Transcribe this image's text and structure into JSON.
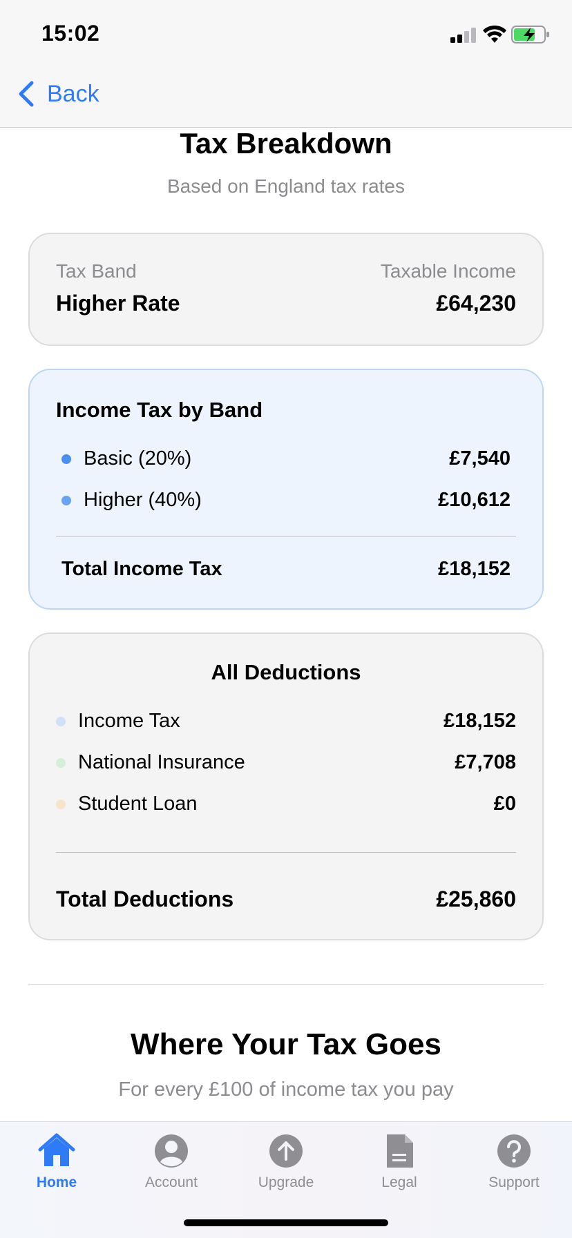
{
  "status_bar": {
    "time": "15:02"
  },
  "nav": {
    "back_label": "Back"
  },
  "header": {
    "title": "Tax Breakdown",
    "subtitle": "Based on England tax rates"
  },
  "band_card": {
    "tax_band_label": "Tax Band",
    "tax_band_value": "Higher Rate",
    "taxable_income_label": "Taxable Income",
    "taxable_income_value": "£64,230"
  },
  "income_tax_card": {
    "title": "Income Tax by Band",
    "rows": [
      {
        "label": "Basic (20%)",
        "value": "£7,540",
        "dot_color": "#4a8ff0"
      },
      {
        "label": "Higher (40%)",
        "value": "£10,612",
        "dot_color": "#6aa3f2"
      }
    ],
    "total_label": "Total Income Tax",
    "total_value": "£18,152"
  },
  "deductions_card": {
    "title": "All Deductions",
    "rows": [
      {
        "label": "Income Tax",
        "value": "£18,152",
        "dot_color": "#cfe0f7"
      },
      {
        "label": "National Insurance",
        "value": "£7,708",
        "dot_color": "#d6eed9"
      },
      {
        "label": "Student Loan",
        "value": "£0",
        "dot_color": "#f6e4cc"
      }
    ],
    "total_label": "Total Deductions",
    "total_value": "£25,860"
  },
  "where_tax_goes": {
    "title": "Where Your Tax Goes",
    "subtitle": "For every £100 of income tax you pay"
  },
  "tab_bar": {
    "tabs": [
      {
        "label": "Home",
        "icon": "house-icon",
        "active": true
      },
      {
        "label": "Account",
        "icon": "person-circle-icon",
        "active": false
      },
      {
        "label": "Upgrade",
        "icon": "arrow-up-circle-icon",
        "active": false
      },
      {
        "label": "Legal",
        "icon": "document-icon",
        "active": false
      },
      {
        "label": "Support",
        "icon": "question-circle-icon",
        "active": false
      }
    ]
  },
  "colors": {
    "accent": "#2f7bf6",
    "muted_text": "#8c8c90",
    "inactive_icon": "#8e8e93"
  }
}
